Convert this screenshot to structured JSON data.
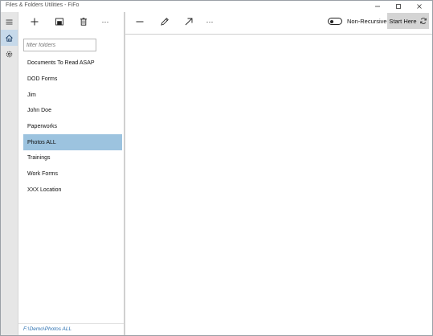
{
  "window": {
    "title": "Files & Folders Utilities - FiFo",
    "controls": [
      "minimize-icon",
      "maximize-icon",
      "close-icon"
    ]
  },
  "rail": {
    "items": [
      {
        "icon": "hamburger-menu-icon"
      },
      {
        "icon": "home-icon",
        "active": true
      },
      {
        "icon": "gear-icon"
      }
    ]
  },
  "left_toolbar": {
    "buttons": [
      "add-icon",
      "save-icon",
      "delete-icon",
      "more-icon"
    ],
    "more_label": "···"
  },
  "filter": {
    "placeholder": "filter folders",
    "value": ""
  },
  "folders": [
    {
      "label": "Documents To Read ASAP"
    },
    {
      "label": "DOD Forms"
    },
    {
      "label": "Jim"
    },
    {
      "label": "John Doe"
    },
    {
      "label": "Paperworks"
    },
    {
      "label": "Photos ALL",
      "selected": true
    },
    {
      "label": "Trainings"
    },
    {
      "label": "Work Forms"
    },
    {
      "label": "XXX Location"
    }
  ],
  "status": {
    "path": "F:\\Demo\\Photos ALL"
  },
  "right_toolbar": {
    "buttons": [
      "minus-icon",
      "pencil-icon",
      "arrow-up-right-icon",
      "more-icon"
    ],
    "more_label": "···",
    "toggle": {
      "label": "Non-Recursive",
      "on": false
    },
    "start_button": {
      "label": "Start Here",
      "icon": "refresh-icon"
    }
  },
  "colors": {
    "selection": "#9cc3df",
    "rail_active": "#c6d9ea",
    "path_text": "#2a6fb0",
    "start_button_bg": "#d4d4d4"
  }
}
